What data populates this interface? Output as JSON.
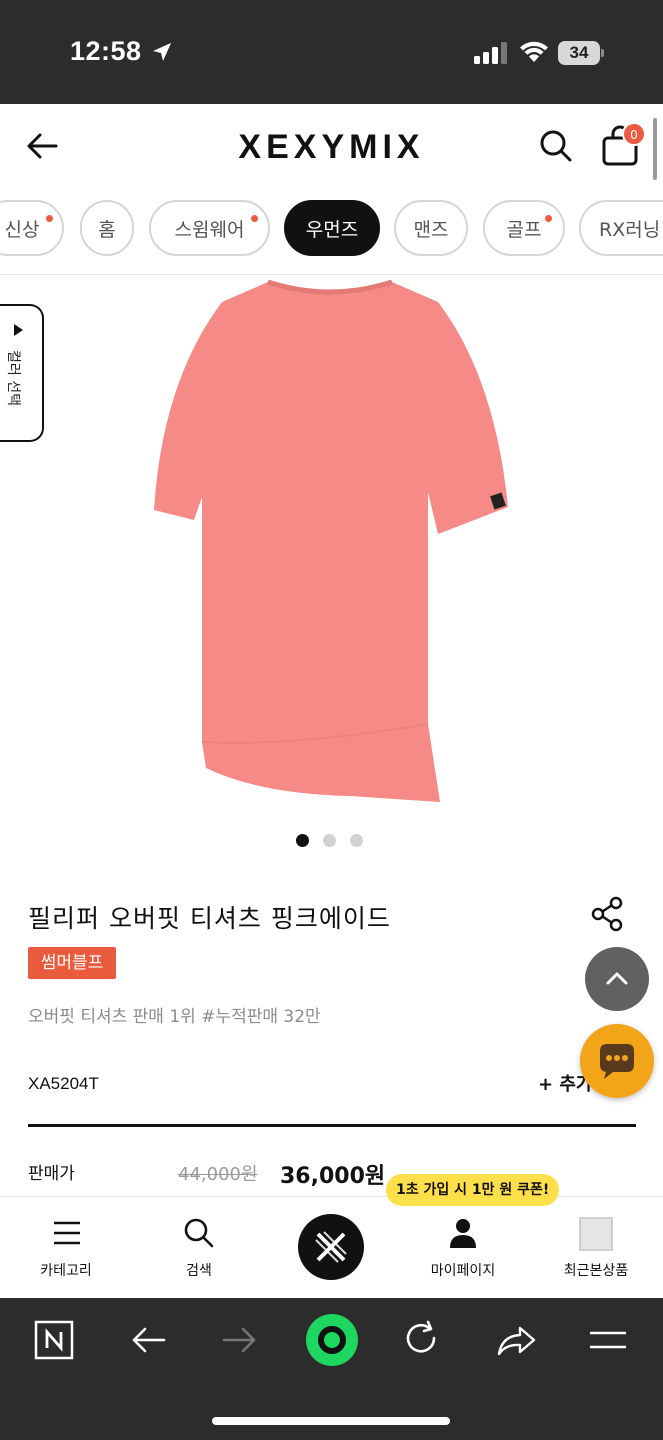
{
  "status_bar": {
    "time": "12:58",
    "battery": "34"
  },
  "header": {
    "logo": "XEXYMIX",
    "cart_count": "0"
  },
  "categories": [
    {
      "label": "신상",
      "dot": true
    },
    {
      "label": "홈",
      "dot": false
    },
    {
      "label": "스윔웨어",
      "dot": true
    },
    {
      "label": "우먼즈",
      "dot": false,
      "active": true
    },
    {
      "label": "맨즈",
      "dot": false
    },
    {
      "label": "골프",
      "dot": true
    },
    {
      "label": "RX러닝",
      "dot": false
    }
  ],
  "side_tab": {
    "label": "컬러 선택"
  },
  "product": {
    "image_color": "#f58a86",
    "title": "필리퍼 오버핏 티셔츠 핑크에이드",
    "badge": "썸머블프",
    "description": "오버핏 티셔츠 판매 1위 #누적판매 32만",
    "code": "XA5204T",
    "add_more": "+ 추가",
    "price_label": "판매가",
    "original_price": "44,000원",
    "sale_price": "36,000원",
    "image_dots": {
      "total": 3,
      "active": 1
    }
  },
  "coupon_tooltip": "1초 가입 시 1만 원 쿠폰!",
  "bottom_nav": [
    {
      "label": "카테고리",
      "icon": "menu-icon"
    },
    {
      "label": "검색",
      "icon": "search-icon"
    },
    {
      "label": "",
      "icon": "home-logo-icon"
    },
    {
      "label": "마이페이지",
      "icon": "user-icon"
    },
    {
      "label": "최근본상품",
      "icon": "recent-product-icon"
    }
  ],
  "colors": {
    "accent": "#ea5b3d",
    "chat": "#f3a51a",
    "dark_bar": "#2c2c2c",
    "naver_green": "#1ed760"
  }
}
